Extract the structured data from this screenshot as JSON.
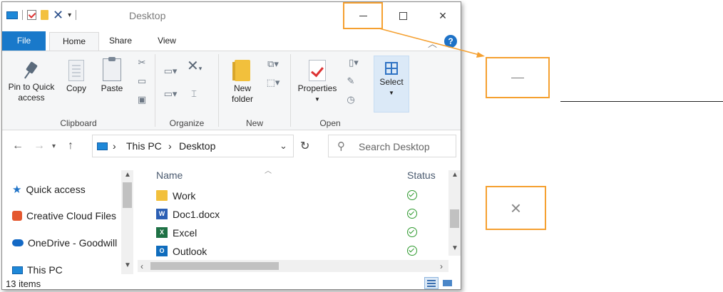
{
  "title_bar": {
    "title": "Desktop",
    "minimize_glyph": "—",
    "close_glyph": "×"
  },
  "ribbon_tabs": [
    "File",
    "Home",
    "Share",
    "View"
  ],
  "ribbon": {
    "clipboard": {
      "pin_label_1": "Pin to Quick",
      "pin_label_2": "access",
      "copy_label": "Copy",
      "paste_label": "Paste",
      "group_label": "Clipboard"
    },
    "organize": {
      "group_label": "Organize"
    },
    "new": {
      "new_folder_1": "New",
      "new_folder_2": "folder",
      "group_label": "New"
    },
    "open": {
      "properties_label": "Properties",
      "group_label": "Open"
    },
    "select": {
      "select_label": "Select"
    }
  },
  "address": {
    "crumbs": [
      "This PC",
      "Desktop"
    ],
    "separator": "›",
    "search_placeholder": "Search Desktop"
  },
  "nav_pane": {
    "items": [
      "Quick access",
      "Creative Cloud Files",
      "OneDrive - Goodwill",
      "This PC"
    ]
  },
  "file_list": {
    "columns": {
      "name": "Name",
      "status": "Status"
    },
    "rows": [
      {
        "name": "Work",
        "type": "folder",
        "status": "synced"
      },
      {
        "name": "Doc1.docx",
        "type": "word",
        "status": "synced"
      },
      {
        "name": "Excel",
        "type": "excel",
        "status": "synced"
      },
      {
        "name": "Outlook",
        "type": "outlook",
        "status": "synced"
      }
    ]
  },
  "status_bar": {
    "item_count": "13 items"
  },
  "colors": {
    "accent": "#1979ca",
    "highlight": "#f5a030",
    "status_ok": "#2e9a2e"
  },
  "icons": {
    "minimize": "minimize-icon",
    "maximize": "maximize-icon",
    "close": "close-icon",
    "search": "search-icon",
    "refresh": "refresh-icon"
  }
}
